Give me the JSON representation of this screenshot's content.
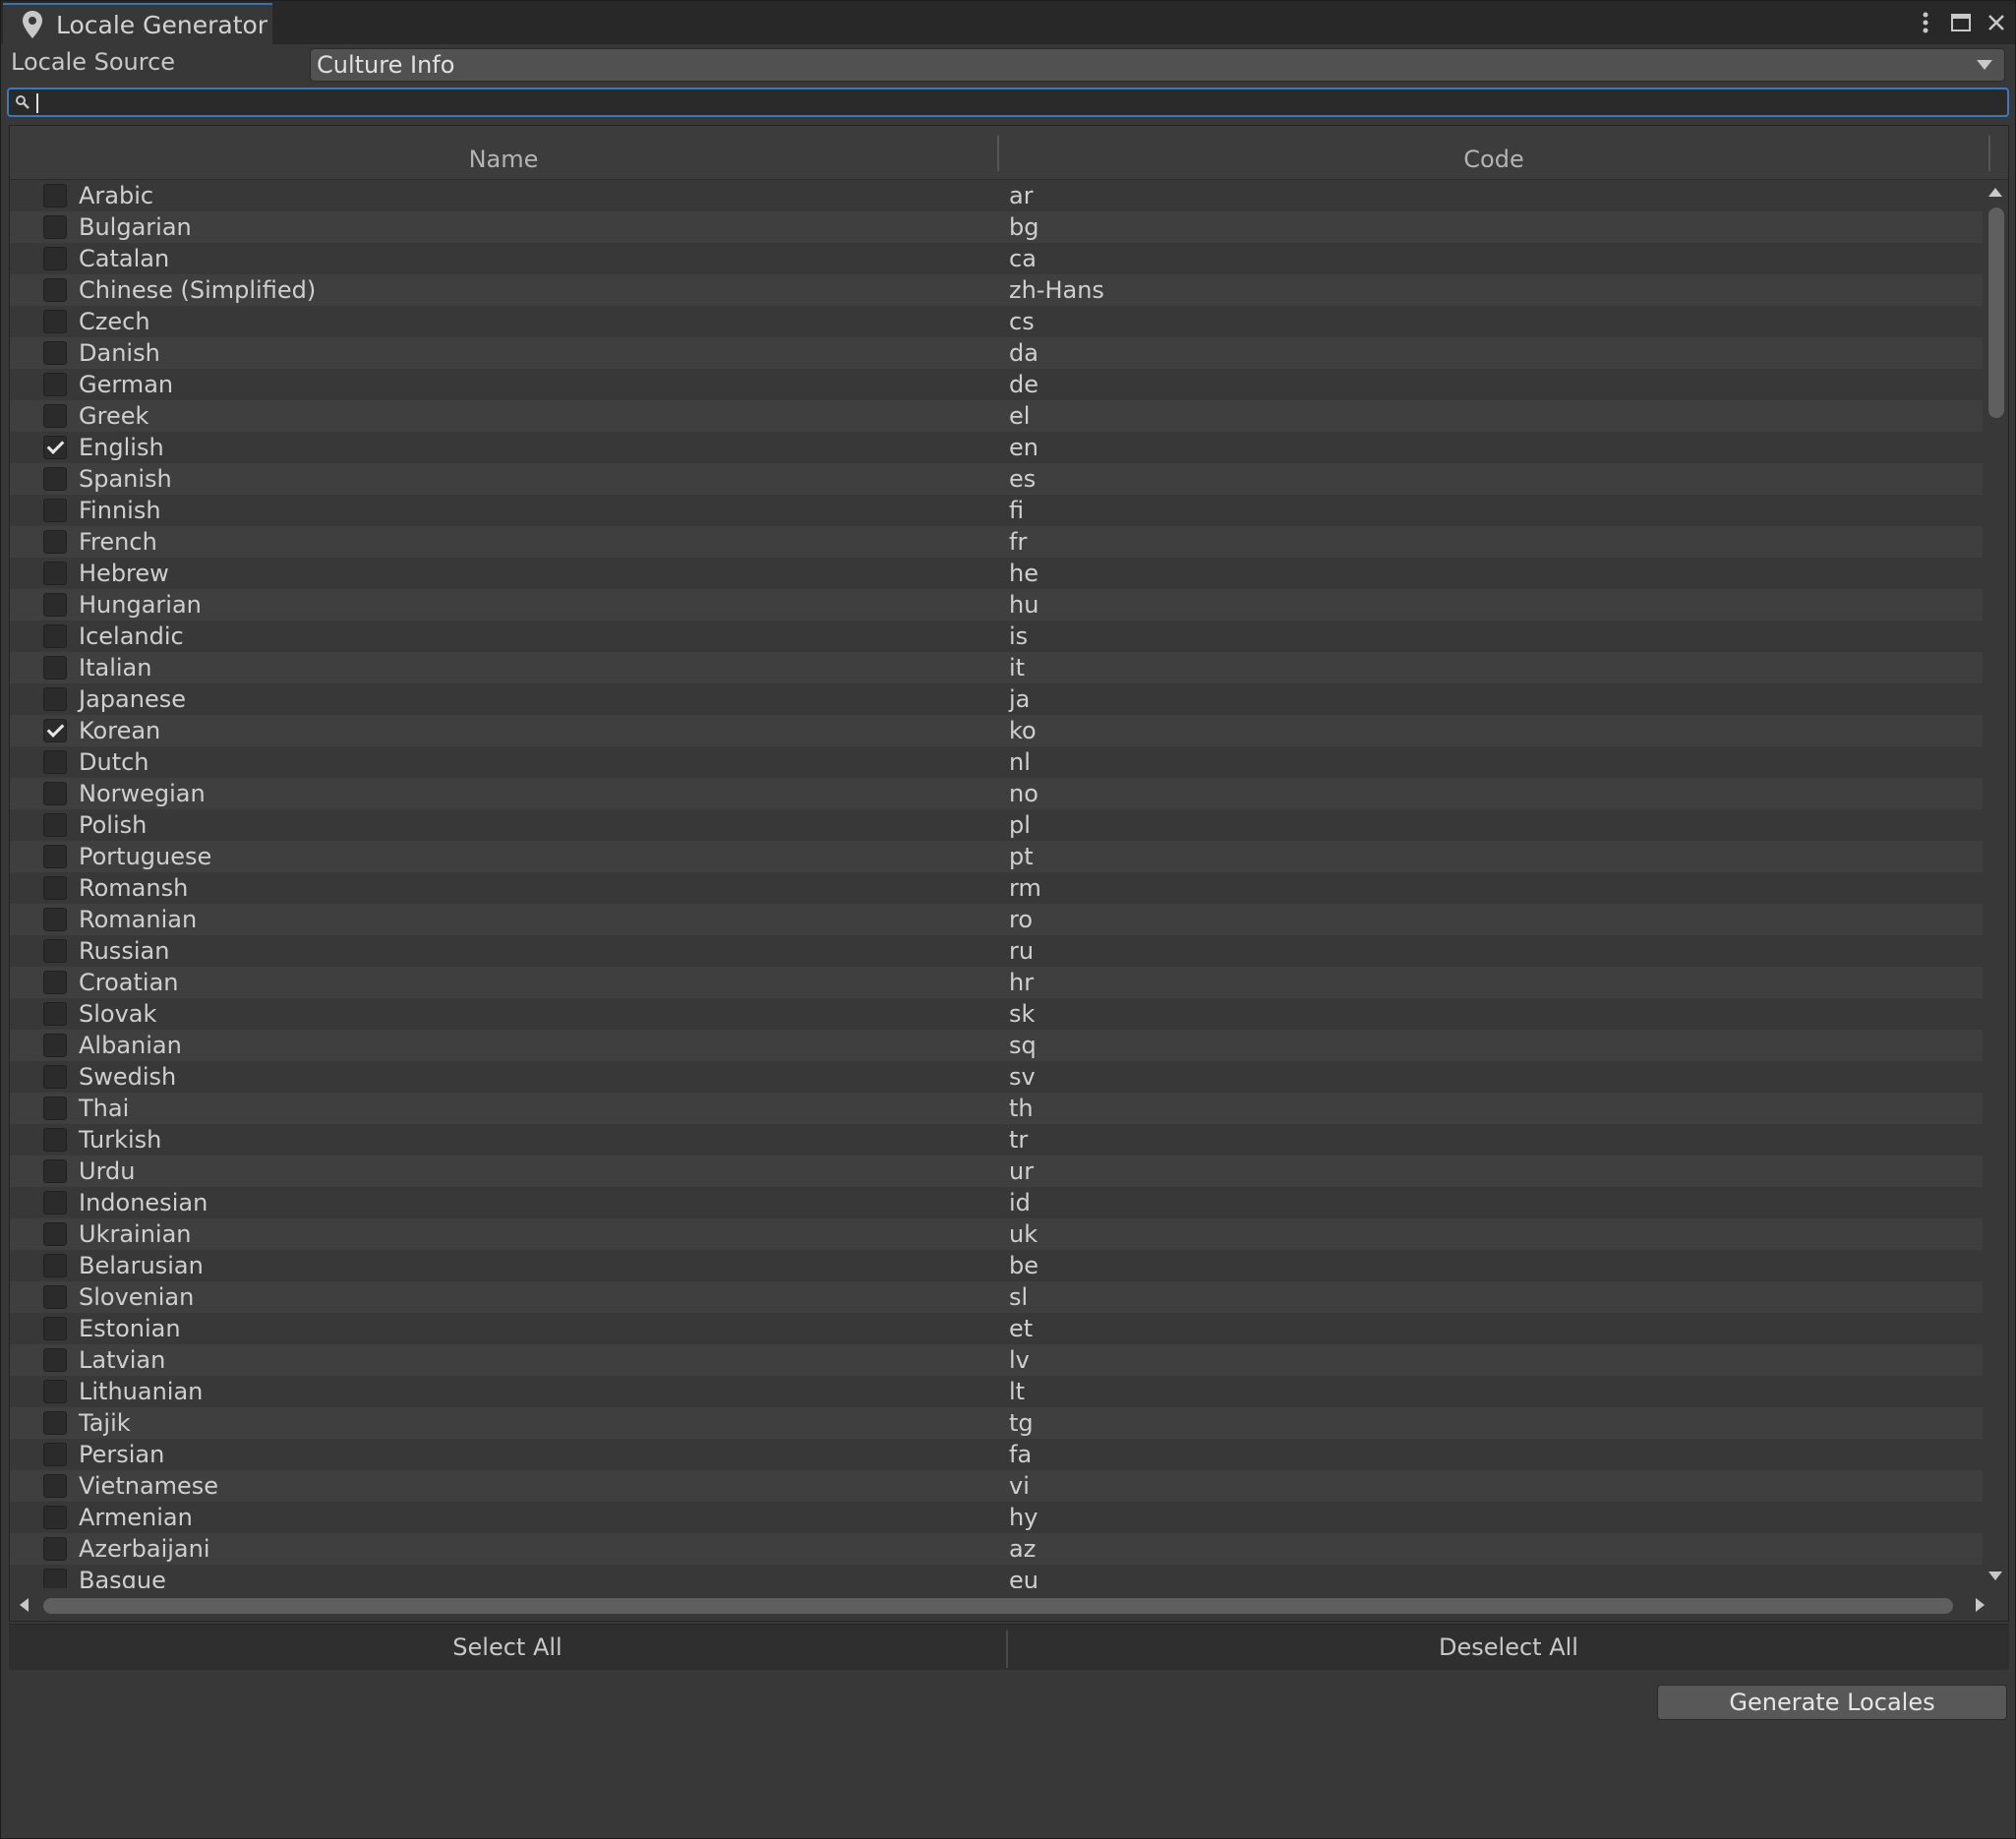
{
  "window": {
    "title": "Locale Generator",
    "icon": "location-pin-icon",
    "controls": [
      "more-options-icon",
      "maximize-icon",
      "close-icon"
    ]
  },
  "source": {
    "label": "Locale Source",
    "selected": "Culture Info"
  },
  "search": {
    "value": "",
    "placeholder": ""
  },
  "table": {
    "headers": {
      "name": "Name",
      "code": "Code"
    },
    "rows": [
      {
        "name": "Arabic",
        "code": "ar",
        "checked": false
      },
      {
        "name": "Bulgarian",
        "code": "bg",
        "checked": false
      },
      {
        "name": "Catalan",
        "code": "ca",
        "checked": false
      },
      {
        "name": "Chinese (Simplified)",
        "code": "zh-Hans",
        "checked": false
      },
      {
        "name": "Czech",
        "code": "cs",
        "checked": false
      },
      {
        "name": "Danish",
        "code": "da",
        "checked": false
      },
      {
        "name": "German",
        "code": "de",
        "checked": false
      },
      {
        "name": "Greek",
        "code": "el",
        "checked": false
      },
      {
        "name": "English",
        "code": "en",
        "checked": true
      },
      {
        "name": "Spanish",
        "code": "es",
        "checked": false
      },
      {
        "name": "Finnish",
        "code": "fi",
        "checked": false
      },
      {
        "name": "French",
        "code": "fr",
        "checked": false
      },
      {
        "name": "Hebrew",
        "code": "he",
        "checked": false
      },
      {
        "name": "Hungarian",
        "code": "hu",
        "checked": false
      },
      {
        "name": "Icelandic",
        "code": "is",
        "checked": false
      },
      {
        "name": "Italian",
        "code": "it",
        "checked": false
      },
      {
        "name": "Japanese",
        "code": "ja",
        "checked": false
      },
      {
        "name": "Korean",
        "code": "ko",
        "checked": true
      },
      {
        "name": "Dutch",
        "code": "nl",
        "checked": false
      },
      {
        "name": "Norwegian",
        "code": "no",
        "checked": false
      },
      {
        "name": "Polish",
        "code": "pl",
        "checked": false
      },
      {
        "name": "Portuguese",
        "code": "pt",
        "checked": false
      },
      {
        "name": "Romansh",
        "code": "rm",
        "checked": false
      },
      {
        "name": "Romanian",
        "code": "ro",
        "checked": false
      },
      {
        "name": "Russian",
        "code": "ru",
        "checked": false
      },
      {
        "name": "Croatian",
        "code": "hr",
        "checked": false
      },
      {
        "name": "Slovak",
        "code": "sk",
        "checked": false
      },
      {
        "name": "Albanian",
        "code": "sq",
        "checked": false
      },
      {
        "name": "Swedish",
        "code": "sv",
        "checked": false
      },
      {
        "name": "Thai",
        "code": "th",
        "checked": false
      },
      {
        "name": "Turkish",
        "code": "tr",
        "checked": false
      },
      {
        "name": "Urdu",
        "code": "ur",
        "checked": false
      },
      {
        "name": "Indonesian",
        "code": "id",
        "checked": false
      },
      {
        "name": "Ukrainian",
        "code": "uk",
        "checked": false
      },
      {
        "name": "Belarusian",
        "code": "be",
        "checked": false
      },
      {
        "name": "Slovenian",
        "code": "sl",
        "checked": false
      },
      {
        "name": "Estonian",
        "code": "et",
        "checked": false
      },
      {
        "name": "Latvian",
        "code": "lv",
        "checked": false
      },
      {
        "name": "Lithuanian",
        "code": "lt",
        "checked": false
      },
      {
        "name": "Tajik",
        "code": "tg",
        "checked": false
      },
      {
        "name": "Persian",
        "code": "fa",
        "checked": false
      },
      {
        "name": "Vietnamese",
        "code": "vi",
        "checked": false
      },
      {
        "name": "Armenian",
        "code": "hy",
        "checked": false
      },
      {
        "name": "Azerbaijani",
        "code": "az",
        "checked": false
      },
      {
        "name": "Basque",
        "code": "eu",
        "checked": false
      }
    ]
  },
  "actions": {
    "select_all": "Select All",
    "deselect_all": "Deselect All",
    "generate": "Generate Locales"
  },
  "colors": {
    "background": "#383838",
    "accent": "#3a79bb"
  }
}
